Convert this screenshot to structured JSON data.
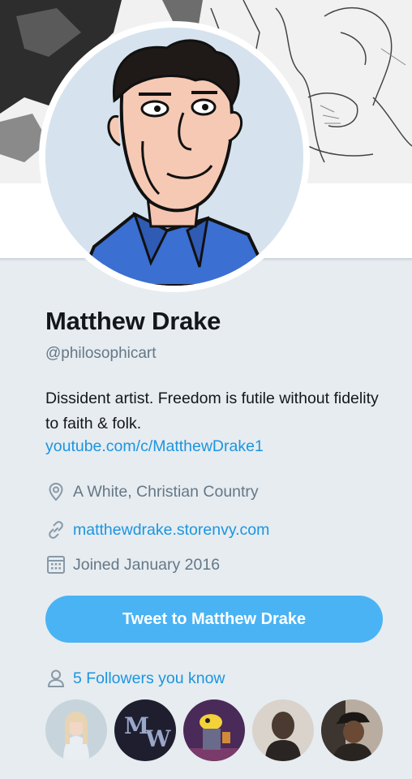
{
  "profile": {
    "name": "Matthew Drake",
    "handle": "@philosophicart",
    "bio": "Dissident artist. Freedom is futile without fidelity to faith & folk.",
    "bio_link": "youtube.com/c/MatthewDrake1"
  },
  "meta": {
    "location_icon": "location-pin-icon",
    "location": "A White, Christian Country",
    "website_icon": "link-icon",
    "website": "matthewdrake.storenvy.com",
    "joined_icon": "calendar-icon",
    "joined": "Joined January 2016"
  },
  "actions": {
    "tweet_button": "Tweet to Matthew Drake"
  },
  "followers": {
    "icon": "person-icon",
    "label": "5 Followers you know",
    "avatars": [
      {
        "name": "follower-avatar-1",
        "color": "#c7d4dc"
      },
      {
        "name": "follower-avatar-2",
        "color": "#262638"
      },
      {
        "name": "follower-avatar-3",
        "color": "#4a2a58"
      },
      {
        "name": "follower-avatar-4",
        "color": "#b9b2aa"
      },
      {
        "name": "follower-avatar-5",
        "color": "#3c3530"
      }
    ]
  },
  "colors": {
    "accent": "#1b95e0",
    "button": "#4ab3f4",
    "muted": "#657786",
    "background": "#e6ecf0"
  }
}
